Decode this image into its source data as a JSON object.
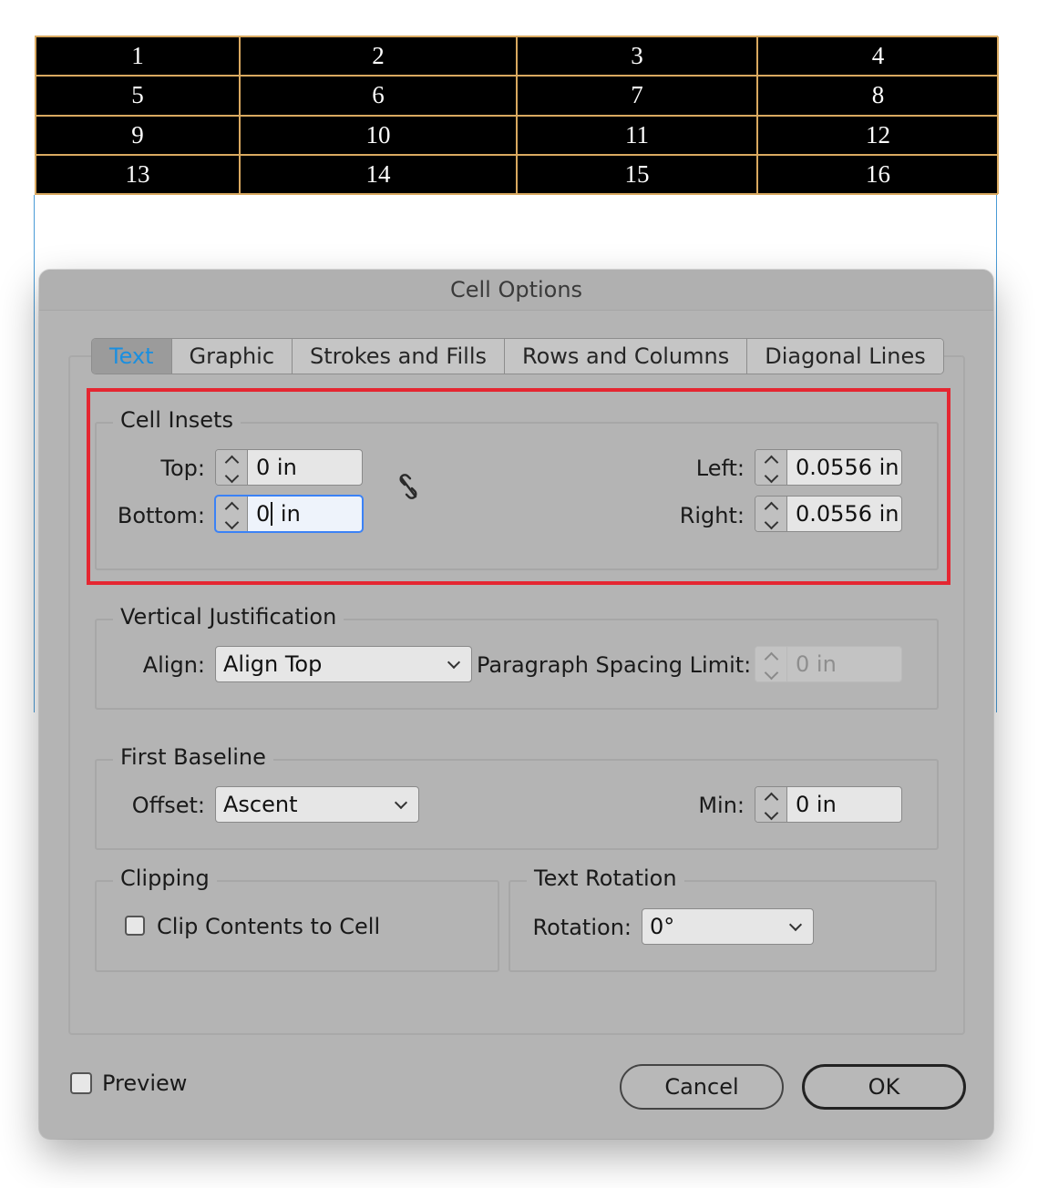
{
  "table": {
    "rows": [
      [
        "1",
        "2",
        "3",
        "4"
      ],
      [
        "5",
        "6",
        "7",
        "8"
      ],
      [
        "9",
        "10",
        "11",
        "12"
      ],
      [
        "13",
        "14",
        "15",
        "16"
      ]
    ]
  },
  "dialog": {
    "title": "Cell Options",
    "tabs": [
      {
        "label": "Text",
        "active": true
      },
      {
        "label": "Graphic",
        "active": false
      },
      {
        "label": "Strokes and Fills",
        "active": false
      },
      {
        "label": "Rows and Columns",
        "active": false
      },
      {
        "label": "Diagonal Lines",
        "active": false
      }
    ],
    "cell_insets": {
      "title": "Cell Insets",
      "top_label": "Top:",
      "top_value": "0 in",
      "bottom_label": "Bottom:",
      "bottom_value_before_caret": "0",
      "bottom_value_after_caret": " in",
      "left_label": "Left:",
      "left_value": "0.0556 in",
      "right_label": "Right:",
      "right_value": "0.0556 in",
      "link_icon": "broken-chain-link-icon"
    },
    "vertical_justification": {
      "title": "Vertical Justification",
      "align_label": "Align:",
      "align_value": "Align Top",
      "spacing_label": "Paragraph Spacing Limit:",
      "spacing_value": "0 in"
    },
    "first_baseline": {
      "title": "First Baseline",
      "offset_label": "Offset:",
      "offset_value": "Ascent",
      "min_label": "Min:",
      "min_value": "0 in"
    },
    "clipping": {
      "title": "Clipping",
      "clip_label": "Clip Contents to Cell",
      "clip_checked": false
    },
    "text_rotation": {
      "title": "Text Rotation",
      "rotation_label": "Rotation:",
      "rotation_value": "0°"
    },
    "preview_label": "Preview",
    "preview_checked": false,
    "cancel_label": "Cancel",
    "ok_label": "OK"
  },
  "colors": {
    "active_tab_text": "#1a8fe0",
    "highlight_box": "#e52631",
    "table_border": "#d9a960"
  }
}
